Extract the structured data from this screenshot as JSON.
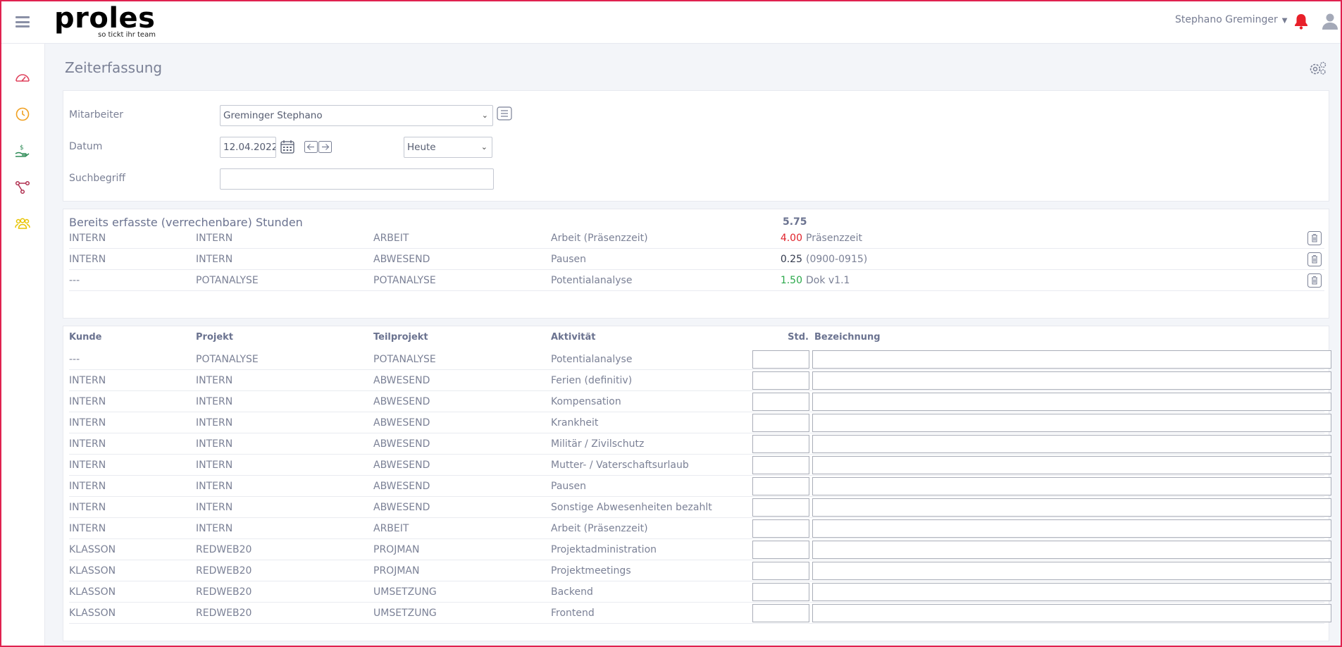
{
  "app": {
    "logo_text": "proles",
    "logo_tagline": "so tickt ihr team",
    "user_name": "Stephano Greminger"
  },
  "colors": {
    "frame": "#e0224f",
    "bell": "#e8202a",
    "red_hours": "#e0222b",
    "green_hours": "#2aa84a"
  },
  "sidebar": {
    "items": [
      {
        "icon": "speedometer-icon",
        "color": "#e0445f"
      },
      {
        "icon": "clock-icon",
        "color": "#f0a020"
      },
      {
        "icon": "money-hand-icon",
        "color": "#2e8b57"
      },
      {
        "icon": "network-icon",
        "color": "#b03050"
      },
      {
        "icon": "team-icon",
        "color": "#e8c400"
      }
    ]
  },
  "page": {
    "title": "Zeiterfassung"
  },
  "filters": {
    "mitarbeiter_label": "Mitarbeiter",
    "mitarbeiter_value": "Greminger Stephano",
    "datum_label": "Datum",
    "datum_value": "12.04.2022",
    "period_value": "Heute",
    "suchbegriff_label": "Suchbegriff",
    "suchbegriff_value": ""
  },
  "summary": {
    "title": "Bereits erfasste (verrechenbare) Stunden",
    "total": "5.75",
    "rows": [
      {
        "kunde": "INTERN",
        "projekt": "INTERN",
        "teilprojekt": "ARBEIT",
        "aktivitaet": "Arbeit (Präsenzzeit)",
        "hours": "4.00",
        "hours_color": "#e0222b",
        "note": "Präsenzzeit"
      },
      {
        "kunde": "INTERN",
        "projekt": "INTERN",
        "teilprojekt": "ABWESEND",
        "aktivitaet": "Pausen",
        "hours": "0.25",
        "hours_color": "#333a4d",
        "note": "(0900-0915)"
      },
      {
        "kunde": "---",
        "projekt": "POTANALYSE",
        "teilprojekt": "POTANALYSE",
        "aktivitaet": "Potentialanalyse",
        "hours": "1.50",
        "hours_color": "#2aa84a",
        "note": "Dok v1.1"
      }
    ]
  },
  "entry_table": {
    "headers": {
      "kunde": "Kunde",
      "projekt": "Projekt",
      "teilprojekt": "Teilprojekt",
      "aktivitaet": "Aktivität",
      "std": "Std.",
      "bezeichnung": "Bezeichnung"
    },
    "rows": [
      {
        "kunde": "---",
        "projekt": "POTANALYSE",
        "teilprojekt": "POTANALYSE",
        "aktivitaet": "Potentialanalyse"
      },
      {
        "kunde": "INTERN",
        "projekt": "INTERN",
        "teilprojekt": "ABWESEND",
        "aktivitaet": "Ferien (definitiv)"
      },
      {
        "kunde": "INTERN",
        "projekt": "INTERN",
        "teilprojekt": "ABWESEND",
        "aktivitaet": "Kompensation"
      },
      {
        "kunde": "INTERN",
        "projekt": "INTERN",
        "teilprojekt": "ABWESEND",
        "aktivitaet": "Krankheit"
      },
      {
        "kunde": "INTERN",
        "projekt": "INTERN",
        "teilprojekt": "ABWESEND",
        "aktivitaet": "Militär / Zivilschutz"
      },
      {
        "kunde": "INTERN",
        "projekt": "INTERN",
        "teilprojekt": "ABWESEND",
        "aktivitaet": "Mutter- / Vaterschaftsurlaub"
      },
      {
        "kunde": "INTERN",
        "projekt": "INTERN",
        "teilprojekt": "ABWESEND",
        "aktivitaet": "Pausen"
      },
      {
        "kunde": "INTERN",
        "projekt": "INTERN",
        "teilprojekt": "ABWESEND",
        "aktivitaet": "Sonstige Abwesenheiten bezahlt"
      },
      {
        "kunde": "INTERN",
        "projekt": "INTERN",
        "teilprojekt": "ARBEIT",
        "aktivitaet": "Arbeit (Präsenzzeit)"
      },
      {
        "kunde": "KLASSON",
        "projekt": "REDWEB20",
        "teilprojekt": "PROJMAN",
        "aktivitaet": "Projektadministration"
      },
      {
        "kunde": "KLASSON",
        "projekt": "REDWEB20",
        "teilprojekt": "PROJMAN",
        "aktivitaet": "Projektmeetings"
      },
      {
        "kunde": "KLASSON",
        "projekt": "REDWEB20",
        "teilprojekt": "UMSETZUNG",
        "aktivitaet": "Backend"
      },
      {
        "kunde": "KLASSON",
        "projekt": "REDWEB20",
        "teilprojekt": "UMSETZUNG",
        "aktivitaet": "Frontend"
      }
    ]
  }
}
